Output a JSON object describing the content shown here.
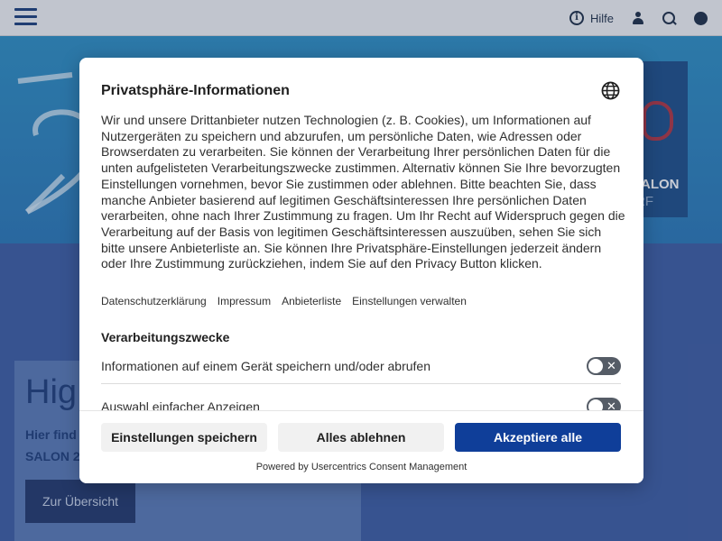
{
  "topbar": {
    "help_label": "Hilfe",
    "icons": [
      "menu-icon",
      "info-icon",
      "user-icon",
      "search-icon",
      "globe-icon"
    ]
  },
  "background": {
    "hero_brand_line1": "SALON",
    "hero_brand_line2": "RF",
    "teaser_heading": "Hig",
    "teaser_line1": "Hier find",
    "teaser_line2": "SALON 20",
    "teaser_button": "Zur Übersicht"
  },
  "dialog": {
    "title": "Privatsphäre-Informationen",
    "body": "Wir und unsere Drittanbieter nutzen Technologien (z. B. Cookies), um Informationen auf Nutzergeräten zu speichern und abzurufen, um persönliche Daten, wie Adressen oder Browserdaten zu verarbeiten. Sie können der Verarbeitung Ihrer persönlichen Daten für die unten aufgelisteten Verarbeitungszwecke zustimmen. Alternativ können Sie Ihre bevorzugten Einstellungen vornehmen, bevor Sie zustimmen oder ablehnen. Bitte beachten Sie, dass manche Anbieter basierend auf legitimen Geschäftsinteressen Ihre persönlichen Daten verarbeiten, ohne nach Ihrer Zustimmung zu fragen. Um Ihr Recht auf Widerspruch gegen die Verarbeitung auf der Basis von legitimen Geschäftsinteressen auszuüben, sehen Sie sich bitte unsere Anbieterliste an. Sie können Ihre Privatsphäre-Einstellungen jederzeit ändern oder Ihre Zustimmung zurückziehen, indem Sie auf den Privacy Button klicken.",
    "links": [
      "Datenschutzerklärung",
      "Impressum",
      "Anbieterliste",
      "Einstellungen verwalten"
    ],
    "section_title": "Verarbeitungszwecke",
    "purposes": [
      {
        "label": "Informationen auf einem Gerät speichern und/oder abrufen",
        "enabled": false
      },
      {
        "label": "Auswahl einfacher Anzeigen",
        "enabled": false
      }
    ],
    "buttons": {
      "save": "Einstellungen speichern",
      "reject": "Alles ablehnen",
      "accept": "Akzeptiere alle"
    },
    "powered_by": "Powered by Usercentrics Consent Management",
    "accent_color": "#0f3e99"
  }
}
